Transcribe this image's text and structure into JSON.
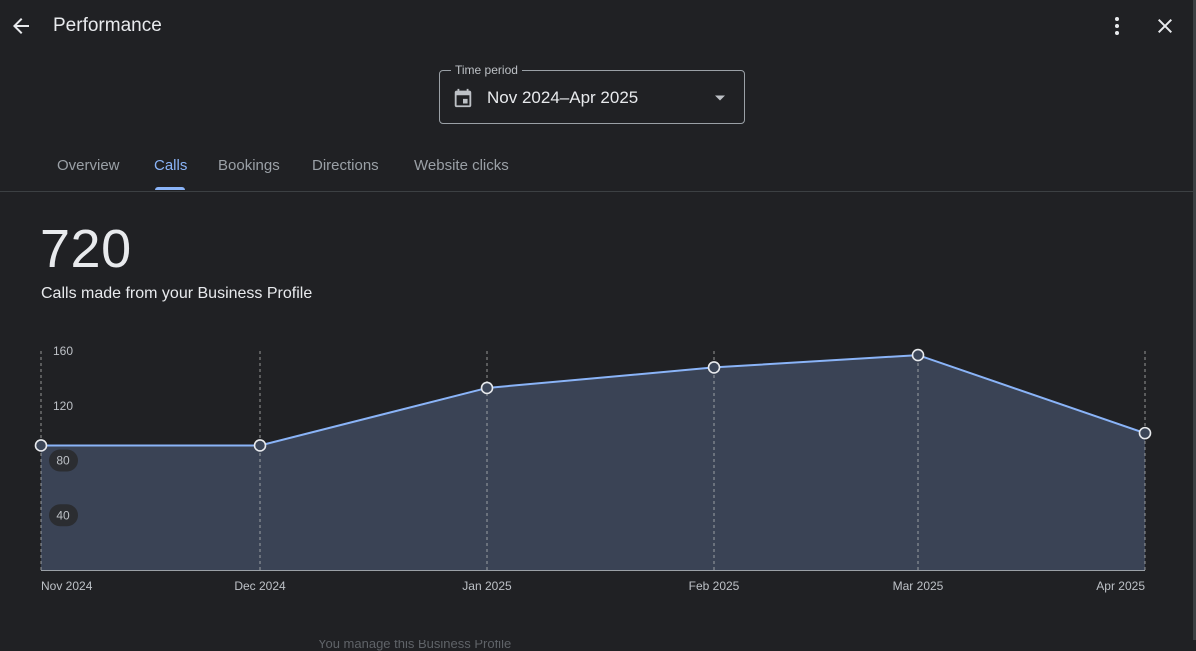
{
  "header": {
    "title": "Performance",
    "back_icon": "arrow-back-icon",
    "more_icon": "more-vert-icon",
    "close_icon": "close-icon"
  },
  "time_period": {
    "label": "Time period",
    "value": "Nov 2024–Apr 2025",
    "icon": "calendar-icon"
  },
  "tabs": [
    {
      "label": "Overview",
      "active": false
    },
    {
      "label": "Calls",
      "active": true
    },
    {
      "label": "Bookings",
      "active": false
    },
    {
      "label": "Directions",
      "active": false
    },
    {
      "label": "Website clicks",
      "active": false
    }
  ],
  "summary": {
    "total": "720",
    "caption": "Calls made from your Business Profile"
  },
  "chart_data": {
    "type": "area",
    "categories": [
      "Nov 2024",
      "Dec 2024",
      "Jan 2025",
      "Feb 2025",
      "Mar 2025",
      "Apr 2025"
    ],
    "values": [
      91,
      91,
      133,
      148,
      157,
      100
    ],
    "ylim": [
      0,
      160
    ],
    "yticks": [
      "40",
      "80",
      "120",
      "160"
    ],
    "grid": "vertical-dashed",
    "line_color": "#8ab4f8",
    "fill_color": "#3c4658"
  },
  "footer": {
    "partial_text": "You manage this Business Profile"
  }
}
